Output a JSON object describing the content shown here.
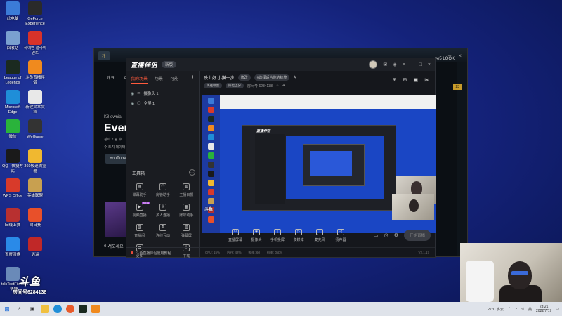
{
  "desktop": {
    "icons": [
      {
        "label": "此电脑",
        "icon": "computer-icon",
        "color": "#3b7bd8"
      },
      {
        "label": "GeForce Experience",
        "icon": "geforce-icon",
        "color": "#2a2a2a"
      },
      {
        "label": "回收站",
        "icon": "recycle-bin-icon",
        "color": "#7aa0d0"
      },
      {
        "label": "하이엔 플라이언트",
        "icon": "app-icon",
        "color": "#d8322a"
      },
      {
        "label": "League of Legends",
        "icon": "lol-icon",
        "color": "#1b2a20"
      },
      {
        "label": "斗鱼直播伴侣",
        "icon": "douyu-companion-icon",
        "color": "#f08a1e"
      },
      {
        "label": "Microsoft Edge",
        "icon": "edge-icon",
        "color": "#1f8ed8"
      },
      {
        "label": "新建文本文档",
        "icon": "text-document-icon",
        "color": "#e8e8e8"
      },
      {
        "label": "微信",
        "icon": "wechat-icon",
        "color": "#2ab33b"
      },
      {
        "label": "WeGame",
        "icon": "wegame-icon",
        "color": "#333333"
      },
      {
        "label": "QQ - 快捷方式",
        "icon": "qq-icon",
        "color": "#1a1a1a"
      },
      {
        "label": "360极速浏览器",
        "icon": "360-browser-icon",
        "color": "#f0b830"
      },
      {
        "label": "WPS Office",
        "icon": "wps-icon",
        "color": "#d83a2a"
      },
      {
        "label": "英雄联盟",
        "icon": "lol-cn-icon",
        "color": "#c8a050"
      },
      {
        "label": "lol线上赛",
        "icon": "lol-online-icon",
        "color": "#b83030"
      },
      {
        "label": "向日葵",
        "icon": "sunflower-icon",
        "color": "#e8502a"
      },
      {
        "label": "百度网盘",
        "icon": "baidu-netdisk-icon",
        "color": "#2a8ae8"
      },
      {
        "label": "逍遥",
        "icon": "xiaoyao-icon",
        "color": "#c02828"
      },
      {
        "label": "tclsTestFileScre... - 快捷",
        "icon": "shortcut-icon",
        "color": "#6a8ab8"
      }
    ]
  },
  "game_window": {
    "tag": "개",
    "right_label": "ve5 LOOK",
    "tabs": [
      "개요",
      "대"
    ],
    "headline_kr": "K8 ownia",
    "headline": "Every",
    "sub1": "징마 2 평 수",
    "sub2": "수 토지 데이터",
    "youtube": "YouTube",
    "caption": "어서오세요, 가",
    "right_num": "23"
  },
  "obs": {
    "logo": "直播伴侣",
    "version": "新版",
    "scene_tabs": [
      "我的场景",
      "场景",
      "可能"
    ],
    "sources": [
      {
        "label": "摄像头 1"
      },
      {
        "label": "全屏 1"
      }
    ],
    "tools_title": "工具箱",
    "tools": [
      {
        "label": "弹幕助手",
        "glyph": "▤",
        "new": false
      },
      {
        "label": "房管助手",
        "glyph": "⚇",
        "new": false
      },
      {
        "label": "主播日报",
        "glyph": "▥",
        "new": false
      },
      {
        "label": "视频直播",
        "glyph": "▶",
        "new": true
      },
      {
        "label": "多人连播",
        "glyph": "⇩",
        "new": false
      },
      {
        "label": "账号助手",
        "glyph": "▦",
        "new": false
      },
      {
        "label": "直播间",
        "glyph": "▧",
        "new": false
      },
      {
        "label": "连线互动",
        "glyph": "⇅",
        "new": false
      },
      {
        "label": "弹幕屏",
        "glyph": "▨",
        "new": false
      },
      {
        "label": "更多",
        "glyph": "▩",
        "new": false
      },
      {
        "label": "",
        "glyph": "",
        "new": false
      },
      {
        "label": "下载",
        "glyph": "⇩",
        "new": false
      }
    ],
    "footer": "斗鱼直播伴侣使用教程",
    "live_title": "晚上好 小猫一步",
    "live_pill": "修改",
    "live_tag": "#选择适合你的标签",
    "meta_category": "英雄联盟",
    "meta_sub": "排位上分",
    "meta_room": "房间号 6284138",
    "meta_count": "4",
    "controls": [
      {
        "label": "直播屏幕",
        "glyph": "⊡"
      },
      {
        "label": "摄像头",
        "glyph": "◉"
      },
      {
        "label": "手机投屏",
        "glyph": "▯"
      },
      {
        "label": "多媒体",
        "glyph": "▷"
      },
      {
        "label": "麦克风",
        "glyph": "♪"
      },
      {
        "label": "扬声器",
        "glyph": "◁"
      }
    ],
    "start_label": "开始直播",
    "status": [
      "CPU: 15%",
      "内存: 42%",
      "帧率: 60",
      "码率: 0kb/s"
    ],
    "version_num": "V2.1.17"
  },
  "douyu": {
    "logo": "斗鱼",
    "room_label": "房间号",
    "room_number": "6284138"
  },
  "taskbar": {
    "weather": "27°C 多云",
    "time": "23:21",
    "date": "2022/7/17",
    "lang": "英"
  }
}
